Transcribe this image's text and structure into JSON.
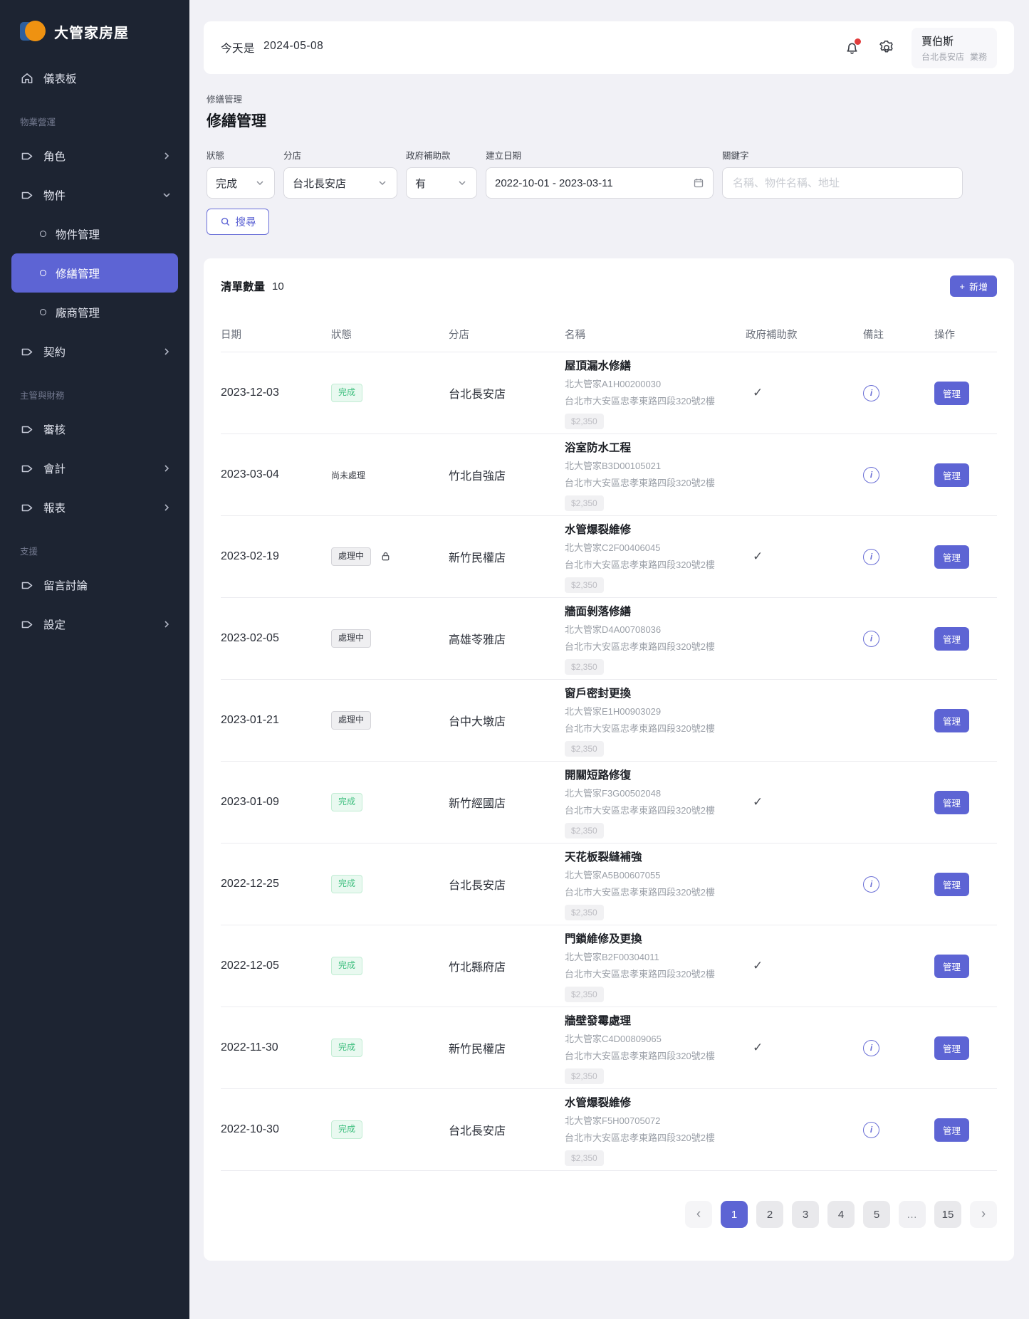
{
  "brand": {
    "name": "大管家房屋"
  },
  "sidebar": {
    "dashboard": "儀表板",
    "sections": {
      "property": "物業營運",
      "finance": "主管與財務",
      "support": "支援"
    },
    "items": {
      "roles": "角色",
      "properties": "物件",
      "contracts": "契約",
      "review": "審核",
      "accounting": "會計",
      "reports": "報表",
      "discussion": "留言討論",
      "settings": "設定"
    },
    "subitems": {
      "property_mgmt": "物件管理",
      "repair_mgmt": "修繕管理",
      "vendor_mgmt": "廠商管理"
    }
  },
  "header": {
    "today_label": "今天是",
    "today_date": "2024-05-08",
    "user": {
      "name": "賈伯斯",
      "branch": "台北長安店",
      "role": "業務"
    }
  },
  "breadcrumb": "修繕管理",
  "page": {
    "title": "修繕管理"
  },
  "filters": {
    "status": {
      "label": "狀態",
      "value": "完成"
    },
    "branch": {
      "label": "分店",
      "value": "台北長安店"
    },
    "subsidy": {
      "label": "政府補助款",
      "value": "有"
    },
    "created": {
      "label": "建立日期",
      "value": "2022-10-01 - 2023-03-11"
    },
    "keyword": {
      "label": "關鍵字",
      "placeholder": "名稱、物件名稱、地址"
    },
    "search_label": "搜尋"
  },
  "list": {
    "count_label": "清單數量",
    "count": "10",
    "add_label": "新增",
    "manage_label": "管理",
    "columns": {
      "date": "日期",
      "status": "狀態",
      "store": "分店",
      "name": "名稱",
      "subsidy": "政府補助款",
      "note": "備註",
      "action": "操作"
    },
    "rows": [
      {
        "date": "2023-12-03",
        "status": "完成",
        "store": "台北長安店",
        "name": "屋頂漏水修繕",
        "code": "北大管家A1H00200030",
        "address": "台北市大安區忠孝東路四段320號2樓",
        "price": "$2,350"
      },
      {
        "date": "2023-03-04",
        "status": "尚未處理",
        "store": "竹北自強店",
        "name": "浴室防水工程",
        "code": "北大管家B3D00105021",
        "address": "台北市大安區忠孝東路四段320號2樓",
        "price": "$2,350"
      },
      {
        "date": "2023-02-19",
        "status": "處理中",
        "store": "新竹民權店",
        "name": "水管爆裂維修",
        "code": "北大管家C2F00406045",
        "address": "台北市大安區忠孝東路四段320號2樓",
        "price": "$2,350"
      },
      {
        "date": "2023-02-05",
        "status": "處理中",
        "store": "高雄苓雅店",
        "name": "牆面剝落修繕",
        "code": "北大管家D4A00708036",
        "address": "台北市大安區忠孝東路四段320號2樓",
        "price": "$2,350"
      },
      {
        "date": "2023-01-21",
        "status": "處理中",
        "store": "台中大墩店",
        "name": "窗戶密封更換",
        "code": "北大管家E1H00903029",
        "address": "台北市大安區忠孝東路四段320號2樓",
        "price": "$2,350"
      },
      {
        "date": "2023-01-09",
        "status": "完成",
        "store": "新竹經國店",
        "name": "開關短路修復",
        "code": "北大管家F3G00502048",
        "address": "台北市大安區忠孝東路四段320號2樓",
        "price": "$2,350"
      },
      {
        "date": "2022-12-25",
        "status": "完成",
        "store": "台北長安店",
        "name": "天花板裂縫補強",
        "code": "北大管家A5B00607055",
        "address": "台北市大安區忠孝東路四段320號2樓",
        "price": "$2,350"
      },
      {
        "date": "2022-12-05",
        "status": "完成",
        "store": "竹北縣府店",
        "name": "門鎖維修及更換",
        "code": "北大管家B2F00304011",
        "address": "台北市大安區忠孝東路四段320號2樓",
        "price": "$2,350"
      },
      {
        "date": "2022-11-30",
        "status": "完成",
        "store": "新竹民權店",
        "name": "牆壁發霉處理",
        "code": "北大管家C4D00809065",
        "address": "台北市大安區忠孝東路四段320號2樓",
        "price": "$2,350"
      },
      {
        "date": "2022-10-30",
        "status": "完成",
        "store": "台北長安店",
        "name": "水管爆裂維修",
        "code": "北大管家F5H00705072",
        "address": "台北市大安區忠孝東路四段320號2樓",
        "price": "$2,350"
      }
    ]
  },
  "pagination": {
    "prev": "‹",
    "pages": [
      "1",
      "2",
      "3",
      "4",
      "5",
      "…",
      "15"
    ],
    "next": "›",
    "active_page": "1"
  },
  "icons": {
    "check": "✓",
    "info": "i",
    "plus": "+"
  },
  "colors": {
    "accent": "#5d64d4",
    "sidebar_bg": "#1d2432",
    "success": "#3fbf7f",
    "page_bg": "#f1f1f6",
    "alert_dot": "#e23d3d"
  }
}
